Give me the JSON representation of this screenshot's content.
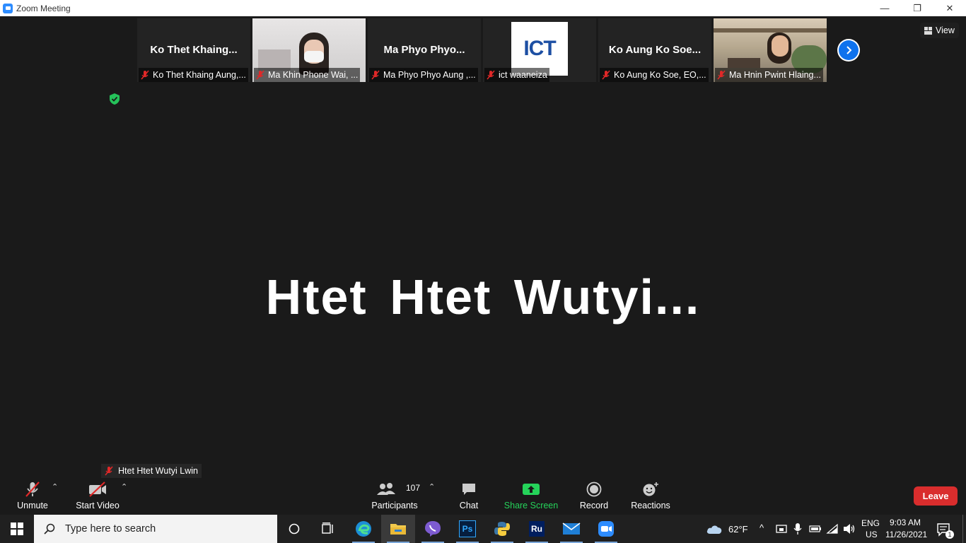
{
  "window": {
    "title": "Zoom Meeting",
    "controls": {
      "minimize": "—",
      "restore": "❐",
      "close": "✕"
    }
  },
  "gallery": {
    "view_label": "View",
    "tiles": [
      {
        "big_name": "Ko Thet Khaing...",
        "label": "Ko Thet Khaing Aung,..."
      },
      {
        "big_name": "",
        "label": "Ma Khin Phone Wai, ..."
      },
      {
        "big_name": "Ma Phyo Phyo...",
        "label": "Ma Phyo Phyo Aung ,..."
      },
      {
        "big_name": "",
        "label": "ict waaneiza",
        "logo_text": "ICT"
      },
      {
        "big_name": "Ko Aung Ko Soe...",
        "label": "Ko Aung Ko Soe, EO,..."
      },
      {
        "big_name": "",
        "label": "Ma Hnin Pwint Hlaing..."
      }
    ]
  },
  "active_speaker": {
    "display_name": "Htet Htet Wutyi...",
    "label": "Htet Htet Wutyi Lwin"
  },
  "toolbar": {
    "unmute": "Unmute",
    "start_video": "Start Video",
    "participants": "Participants",
    "participant_count": "107",
    "chat": "Chat",
    "share_screen": "Share Screen",
    "record": "Record",
    "reactions": "Reactions",
    "leave": "Leave"
  },
  "taskbar": {
    "search_placeholder": "Type here to search",
    "weather": "62°F",
    "lang_top": "ENG",
    "lang_bottom": "US",
    "time": "9:03 AM",
    "date": "11/26/2021",
    "notification_count": "1"
  },
  "colors": {
    "accent_blue": "#0e72ed",
    "share_green": "#25d35a",
    "leave_red": "#d92d2d",
    "mute_red": "#e02828"
  }
}
